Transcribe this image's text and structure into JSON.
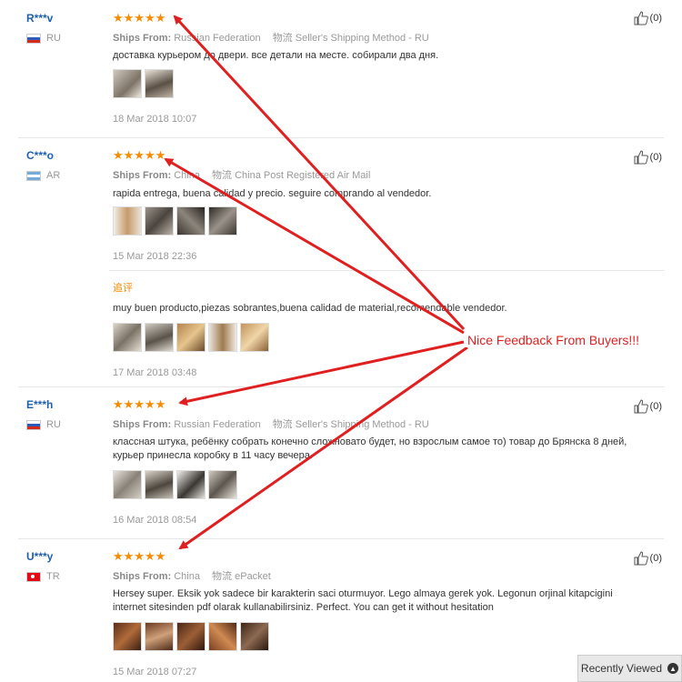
{
  "ships_label": "Ships From:",
  "logistics_label": "物流",
  "stars": "★★★★★",
  "annotation": "Nice Feedback From Buyers!!!",
  "recently_viewed": "Recently Viewed",
  "reviews": [
    {
      "user": "R***v",
      "country": "RU",
      "ships_from": "Russian Federation",
      "method": "Seller's Shipping Method - RU",
      "text": "доставка курьером до двери. все детали на месте. собирали два дня.",
      "date": "18 Mar 2018 10:07",
      "helpful": "(0)"
    },
    {
      "user": "C***o",
      "country": "AR",
      "ships_from": "China",
      "method": "China Post Registered Air Mail",
      "text": "rapida entrega, buena calidad y precio. seguire comprando al vendedor.",
      "date": "15 Mar 2018 22:36",
      "helpful": "(0)",
      "additional_label": "追评",
      "additional_text": "muy buen producto,piezas sobrantes,buena calidad de material,recomendable vendedor.",
      "additional_date": "17 Mar 2018 03:48"
    },
    {
      "user": "E***h",
      "country": "RU",
      "ships_from": "Russian Federation",
      "method": "Seller's Shipping Method - RU",
      "text": "классная штука, ребёнку собрать конечно сложновато будет, но взрослым самое то) товар до Брянска 8 дней, курьер принесла коробку в 11 часу вечера.",
      "date": "16 Mar 2018 08:54",
      "helpful": "(0)"
    },
    {
      "user": "U***y",
      "country": "TR",
      "ships_from": "China",
      "method": "ePacket",
      "text": "Hersey super. Eksik yok sadece bir karakterin saci oturmuyor. Lego almaya gerek yok. Legonun orjinal kitapcigini internet sitesinden pdf olarak kullanabilirsiniz. Perfect. You can get it without hesitation",
      "date": "15 Mar 2018 07:27",
      "helpful": "(0)"
    }
  ]
}
